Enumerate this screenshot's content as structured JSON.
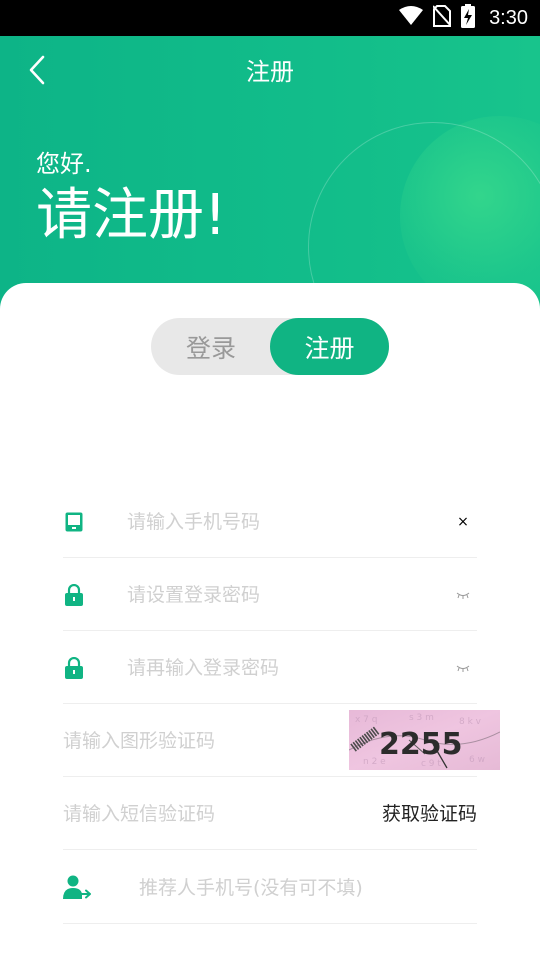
{
  "status_bar": {
    "time": "3:30",
    "icons": [
      "wifi-icon",
      "no-sim-icon",
      "battery-charging-icon"
    ]
  },
  "nav": {
    "title": "注册",
    "back_icon": "chevron-left-icon"
  },
  "header": {
    "greeting": "您好.",
    "headline": "请注册!"
  },
  "tabs": [
    {
      "label": "登录",
      "active": false
    },
    {
      "label": "注册",
      "active": true
    }
  ],
  "form": {
    "phone": {
      "placeholder": "请输入手机号码",
      "value": "",
      "icon": "phone-icon",
      "clear_icon": "×"
    },
    "password": {
      "placeholder": "请设置登录密码",
      "value": "",
      "icon": "lock-icon",
      "toggle_icon": "eye-closed-icon"
    },
    "confirm_password": {
      "placeholder": "请再输入登录密码",
      "value": "",
      "icon": "lock-icon",
      "toggle_icon": "eye-closed-icon"
    },
    "captcha": {
      "placeholder": "请输入图形验证码",
      "value": "",
      "image_text": "2255"
    },
    "sms_code": {
      "placeholder": "请输入短信验证码",
      "value": "",
      "button_label": "获取验证码"
    },
    "referrer": {
      "placeholder": "推荐人手机号(没有可不填)",
      "value": "",
      "icon": "user-share-icon"
    }
  },
  "colors": {
    "primary": "#10b483",
    "placeholder": "#d0d0d0",
    "divider": "#eeeeee",
    "toggle_bg": "#e8e8e8"
  }
}
